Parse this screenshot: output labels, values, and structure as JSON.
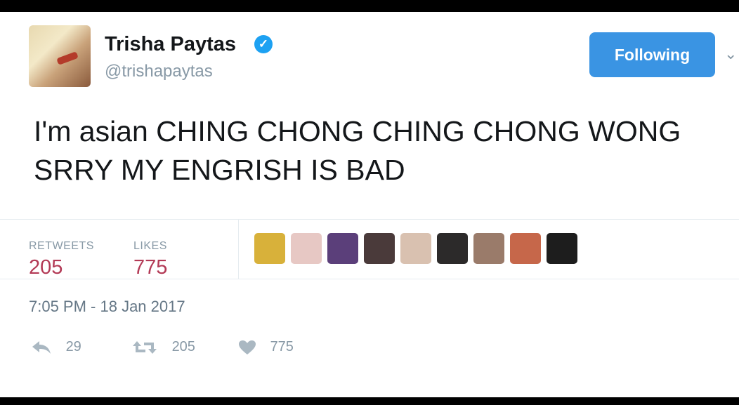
{
  "user": {
    "name": "Trisha Paytas",
    "handle": "@trishapaytas",
    "verified_glyph": "✓",
    "follow_label": "Following"
  },
  "tweet": {
    "text": "I'm asian CHING CHONG CHING CHONG WONG SRRY MY ENGRISH IS BAD",
    "timestamp": "7:05 PM - 18 Jan 2017"
  },
  "stats": {
    "retweets_label": "RETWEETS",
    "retweets_value": "205",
    "likes_label": "LIKES",
    "likes_value": "775"
  },
  "actions": {
    "reply_count": "29",
    "retweet_count": "205",
    "like_count": "775"
  },
  "likers": [
    {
      "color": "#d8b13a"
    },
    {
      "color": "#e7c8c4"
    },
    {
      "color": "#5b3f7a"
    },
    {
      "color": "#4a3a3a"
    },
    {
      "color": "#d9c1b0"
    },
    {
      "color": "#2c2a2a"
    },
    {
      "color": "#9a7b6a"
    },
    {
      "color": "#c6674a"
    },
    {
      "color": "#1d1d1d"
    }
  ],
  "colors": {
    "accent": "#3a94e3",
    "stat_value": "#b33a56",
    "muted": "#8899a6"
  }
}
